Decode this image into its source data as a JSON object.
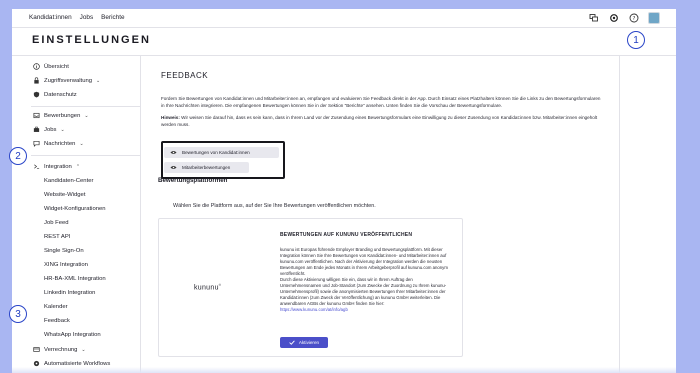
{
  "topnav": {
    "items": [
      "Kandidat:innen",
      "Jobs",
      "Berichte"
    ]
  },
  "topicons": [
    "chat-icon",
    "gear-icon",
    "help-icon",
    "avatar"
  ],
  "page_title": "EINSTELLUNGEN",
  "sidebar": {
    "items": [
      {
        "label": "Übersicht",
        "icon": "info-icon"
      },
      {
        "label": "Zugriffsverwaltung",
        "icon": "lock-icon",
        "chevron": "⌄"
      },
      {
        "label": "Datenschutz",
        "icon": "shield-icon"
      },
      {
        "label": "Bewerbungen",
        "icon": "inbox-icon",
        "chevron": "⌄"
      },
      {
        "label": "Jobs",
        "icon": "briefcase-icon",
        "chevron": "⌄"
      },
      {
        "label": "Nachrichten",
        "icon": "message-icon",
        "chevron": "⌄"
      },
      {
        "label": "Integration",
        "icon": "terminal-icon",
        "chevron": "⌃"
      },
      {
        "label": "Kandidaten-Center"
      },
      {
        "label": "Website-Widget"
      },
      {
        "label": "Widget-Konfigurationen"
      },
      {
        "label": "Job Feed"
      },
      {
        "label": "REST API"
      },
      {
        "label": "Single Sign-On"
      },
      {
        "label": "XING Integration"
      },
      {
        "label": "HR-BA-XML Integration"
      },
      {
        "label": "Linkedin Integration"
      },
      {
        "label": "Kalender"
      },
      {
        "label": "Feedback"
      },
      {
        "label": "WhatsApp Integration"
      },
      {
        "label": "Verrechnung",
        "icon": "card-icon",
        "chevron": "⌄"
      },
      {
        "label": "Automatisierte Workflows",
        "icon": "workflow-icon"
      }
    ]
  },
  "content": {
    "heading": "FEEDBACK",
    "paragraph": "Fordern Sie Bewertungen von Kandidat:innen und Mitarbeiter:innen an, empfangen und evaluieren Sie Feedback direkt in der App. Durch Einsatz eines Platzhalters können Sie die Links zu den Bewertungsformularen in Ihre Nachrichten integrieren. Die empfangenen Bewertungen können Sie in der Sektion \"Berichte\" ansehen. Unten finden Sie die Vorschau der Bewertungsformulare.",
    "hint_label": "Hinweis:",
    "hint_text": " Wir weisen Sie darauf hin, dass es sein kann, dass in Ihrem Land vor der Zusendung eines Bewertungsformulars eine Einwilligung zu dieser Zusendung von Kandidat:innen bzw. Mitarbeiter:innen eingeholt werden muss.",
    "preview_buttons": [
      "Bewertungen von Kandidat:innen",
      "Mitarbeiterbewertungen"
    ],
    "platforms_heading": "Bewertungsplattformen",
    "platforms_sub": "Wählen Sie die Plattform aus, auf der Sie Ihre Bewertungen veröffentlichen möchten."
  },
  "card": {
    "logo": "kununu",
    "title": "BEWERTUNGEN AUF KUNUNU VERÖFFENTLICHEN",
    "body1": "kununu ist Europas führende Employer Branding und Bewertungsplattform. Mit dieser Integration können Sie Ihre Bewertungen von Kandidat:innen- und Mitarbeiter:innen auf kununu.com veröffentlichen. Nach der Aktivierung der Integration werden die neusten Bewertungen am Ende jedes Monats in Ihrem Arbeitgeberprofil auf kununu.com anonym veröffentlicht.",
    "body2": "Durch diese Aktivierung willigen Sie ein, dass wir in Ihrem Auftrag den Unternehmensnamen und Job-Standort (zum Zwecke der Zuordnung zu Ihrem kununu-Unternehmensprofil) sowie die anonymisierten Bewertungen Ihrer Mitarbeiter:innen der Kandidat:innen (zum Zweck der Veröffentlichung) an kununu GmbH weiterleiten. Die anwendbaren AGBs der kununu GmbH finden Sie hier: ",
    "link": "https://www.kununu.com/at/info/agb",
    "activate_label": "Aktivieren"
  },
  "callouts": [
    "1",
    "2",
    "3"
  ],
  "colors": {
    "accent": "#4b4fc9",
    "background": "#a9b6f2",
    "callout": "#2a45c8"
  }
}
